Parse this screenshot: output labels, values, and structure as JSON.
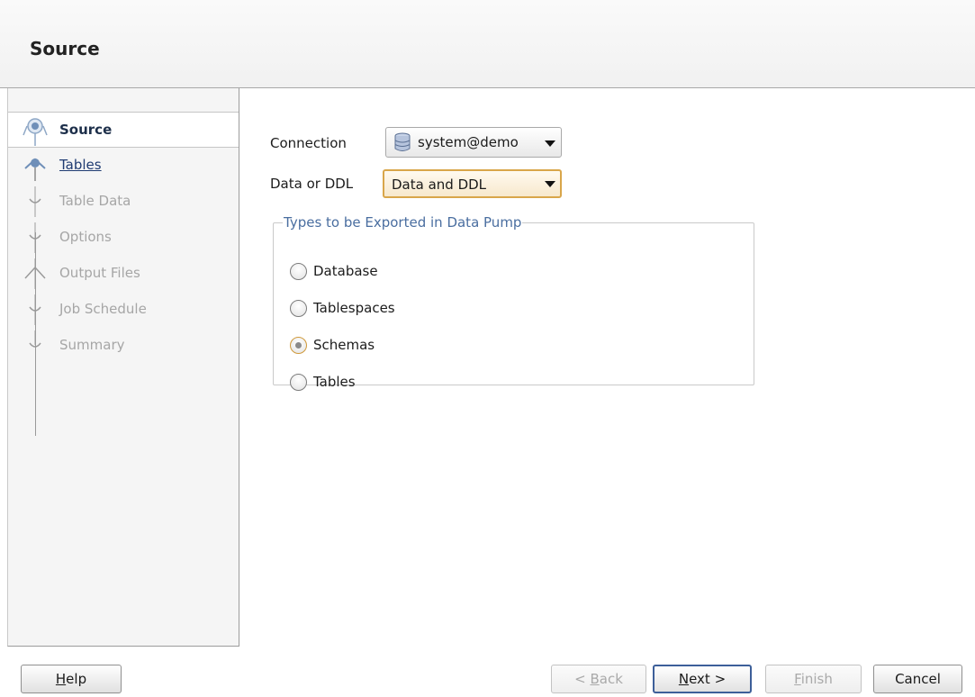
{
  "header": {
    "title": "Source"
  },
  "steps": [
    {
      "label": "Source",
      "state": "active"
    },
    {
      "label": "Tables",
      "state": "link"
    },
    {
      "label": "Table Data",
      "state": "disabled"
    },
    {
      "label": "Options",
      "state": "disabled"
    },
    {
      "label": "Output Files",
      "state": "disabled"
    },
    {
      "label": "Job Schedule",
      "state": "disabled"
    },
    {
      "label": "Summary",
      "state": "disabled"
    }
  ],
  "form": {
    "connection_label": "Connection",
    "connection_value": "system@demo",
    "data_or_ddl_label": "Data or DDL",
    "data_or_ddl_value": "Data and DDL",
    "group_title": "Types to be Exported in Data Pump",
    "options": [
      {
        "label": "Database",
        "selected": false
      },
      {
        "label": "Tablespaces",
        "selected": false
      },
      {
        "label": "Schemas",
        "selected": true
      },
      {
        "label": "Tables",
        "selected": false
      }
    ]
  },
  "buttons": {
    "help": {
      "mnemonic": "H",
      "rest": "elp"
    },
    "back": {
      "prefix": "< ",
      "mnemonic": "B",
      "rest": "ack"
    },
    "next": {
      "mnemonic": "N",
      "rest": "ext >"
    },
    "finish": {
      "mnemonic": "F",
      "rest": "inish"
    },
    "cancel": "Cancel"
  },
  "colors": {
    "accent": "#d9a64a",
    "link": "#1f3b72",
    "group_title": "#4a6ea0"
  }
}
